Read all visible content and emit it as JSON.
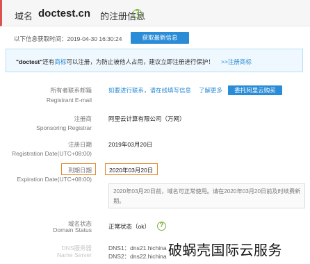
{
  "header": {
    "prefix": "域名",
    "domain": "doctest.cn",
    "suffix": "的注册信息"
  },
  "fetch": {
    "text": "以下信息获取时间：2019-04-30 16:30:24",
    "button": "获取最新信息"
  },
  "notice": {
    "brand": "\"doctest\"",
    "part1": "还有",
    "link1": "商标",
    "part2": "可以注册，为防止被他人占用，建议立即注册进行保护！",
    "link2": ">>注册商标"
  },
  "rows": {
    "email": {
      "label_cn": "所有者联系邮箱",
      "label_en": "Registrant E-mail",
      "contact_link": "如要进行联系，请在线填写信息",
      "more_link": "了解更多",
      "button": "委托阿里云购买"
    },
    "registrar": {
      "label_cn": "注册商",
      "label_en": "Sponsoring Registrar",
      "value": "阿里云计算有限公司（万网）"
    },
    "reg_date": {
      "label_cn": "注册日期",
      "label_en": "Registration Date(UTC+08:00)",
      "value": "2019年03月20日"
    },
    "exp_date": {
      "label_cn": "到期日期",
      "label_en": "Expiration Date(UTC+08:00)",
      "value": "2020年03月20日",
      "note": "2020年03月20日前，域名可正常使用。请在2020年03月20日前及时续费新期。"
    },
    "status": {
      "label_cn": "域名状态",
      "label_en": "Domain Status",
      "value": "正常状态（ok）"
    },
    "dns": {
      "label_cn": "DNS服务器",
      "label_en": "Name Server",
      "dns1": "DNS1：dns21.hichina",
      "dns2": "DNS2：dns22.hichina"
    }
  },
  "watermark": "破蜗壳国际云服务",
  "colors": {
    "accent_blue": "#2a8bd6",
    "header_bar": "#d9534f",
    "highlight": "#e4892a",
    "status_green": "#7ab23c"
  }
}
